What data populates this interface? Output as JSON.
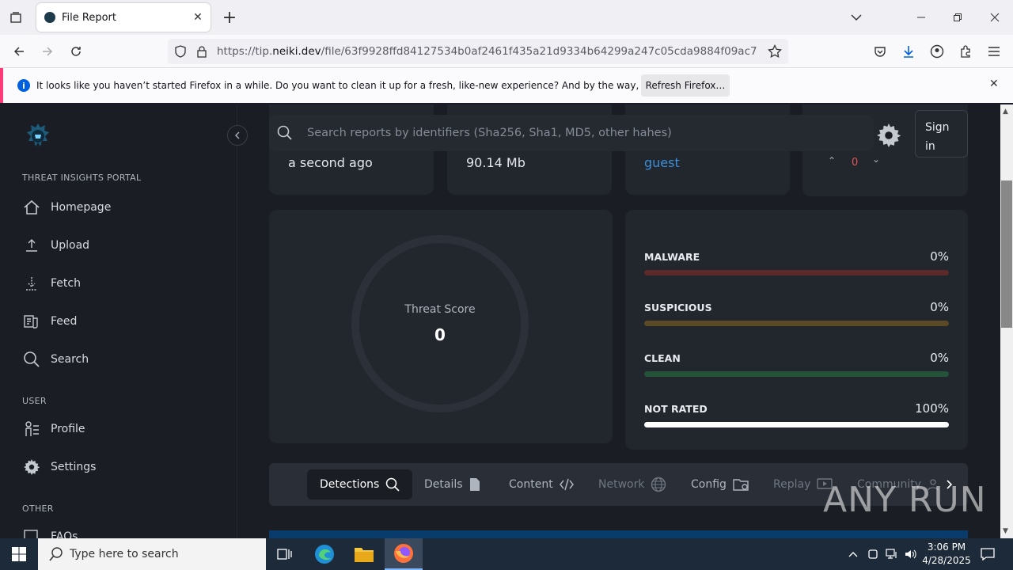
{
  "browser": {
    "tab_title": "File Report",
    "url_prefix": "https://tip.",
    "url_domain": "neiki.dev",
    "url_path": "/file/63f9928ffd84127534b0af2461f435a21d9334b64299a247c05cda9884f09ac7"
  },
  "notification": {
    "message": "It looks like you haven’t started Firefox in a while. Do you want to clean it up for a fresh, like-new experience? And by the way, welcome back!",
    "button": "Refresh Firefox…"
  },
  "sidebar": {
    "section_main": "THREAT INSIGHTS PORTAL",
    "items_main": [
      {
        "label": "Homepage",
        "icon": "home-icon"
      },
      {
        "label": "Upload",
        "icon": "upload-icon"
      },
      {
        "label": "Fetch",
        "icon": "fetch-icon"
      },
      {
        "label": "Feed",
        "icon": "feed-icon"
      },
      {
        "label": "Search",
        "icon": "search-icon"
      }
    ],
    "section_user": "USER",
    "items_user": [
      {
        "label": "Profile",
        "icon": "profile-icon"
      },
      {
        "label": "Settings",
        "icon": "gear-icon"
      }
    ],
    "section_other": "OTHER",
    "items_other": [
      {
        "label": "FAQs",
        "icon": "faq-icon"
      }
    ]
  },
  "header": {
    "search_placeholder": "Search reports by identifiers (Sha256, Sha1, MD5, other hahes)",
    "signin": "Sign in"
  },
  "info_cards": {
    "time": "a second ago",
    "size": "90.14 Mb",
    "user": "guest",
    "votes": "0"
  },
  "threat": {
    "label": "Threat Score",
    "score": "0"
  },
  "verdicts": [
    {
      "label": "MALWARE",
      "pct": "0%",
      "fill": 0,
      "track_color": "#5c2a2a",
      "fill_color": "#d9534f"
    },
    {
      "label": "SUSPICIOUS",
      "pct": "0%",
      "fill": 0,
      "track_color": "#5a4a25",
      "fill_color": "#e0a526"
    },
    {
      "label": "CLEAN",
      "pct": "0%",
      "fill": 0,
      "track_color": "#25533a",
      "fill_color": "#2fae5f"
    },
    {
      "label": "NOT RATED",
      "pct": "100%",
      "fill": 1,
      "track_color": "#3a3f47",
      "fill_color": "#ffffff"
    }
  ],
  "tabs": [
    {
      "label": "Detections",
      "icon": "search-icon"
    },
    {
      "label": "Details",
      "icon": "file-icon"
    },
    {
      "label": "Content",
      "icon": "code-icon"
    },
    {
      "label": "Network",
      "icon": "globe-icon"
    },
    {
      "label": "Config",
      "icon": "config-icon"
    },
    {
      "label": "Replay",
      "icon": "replay-icon"
    },
    {
      "label": "Community",
      "icon": "community-icon"
    }
  ],
  "taskbar": {
    "search_placeholder": "Type here to search",
    "time": "3:06 PM",
    "date": "4/28/2025"
  },
  "watermark": "ANY RUN"
}
